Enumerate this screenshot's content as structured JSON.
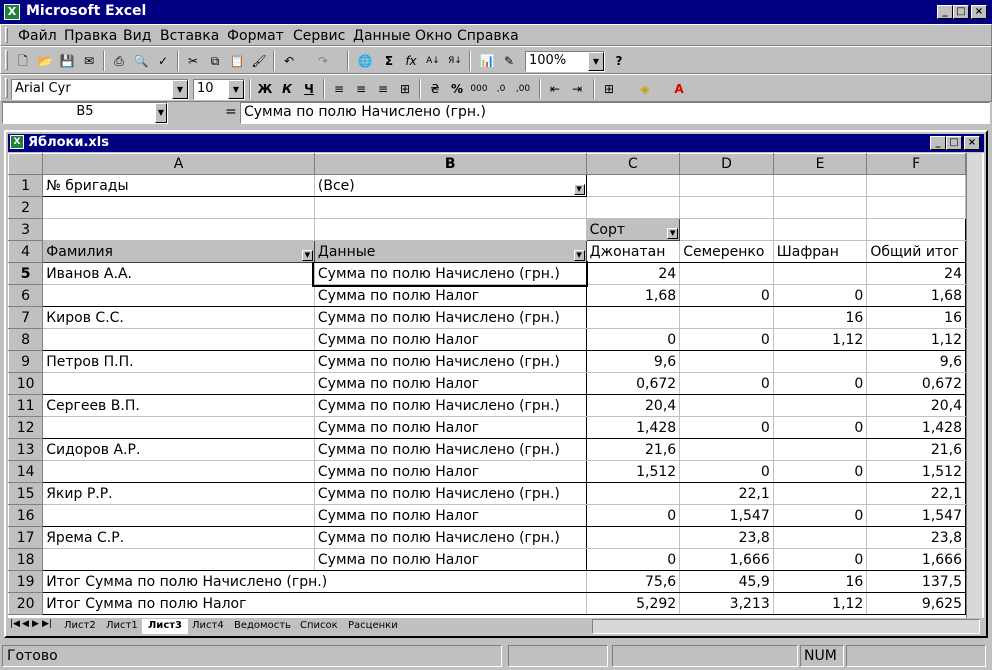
{
  "app": {
    "title": "Microsoft Excel",
    "icon": "excel-icon"
  },
  "menu": [
    "Файл",
    "Правка",
    "Вид",
    "Вставка",
    "Формат",
    "Сервис",
    "Данные",
    "Окно",
    "Справка"
  ],
  "toolbar": {
    "zoom": "100%"
  },
  "format": {
    "font": "Arial Cyr",
    "size": "10"
  },
  "formula_bar": {
    "cell_ref": "B5",
    "equals": "=",
    "content": "Сумма по полю Начислено (грн.)"
  },
  "workbook": {
    "title": "Яблоки.xls"
  },
  "grid": {
    "columns": [
      "A",
      "B",
      "C",
      "D",
      "E",
      "F"
    ],
    "row1": {
      "label": "№ бригады",
      "filter": "(Все)"
    },
    "sort_field": "Сорт",
    "headers": {
      "a": "Фамилия",
      "b": "Данные",
      "c": "Джонатан",
      "d": "Семеренко",
      "e": "Шафран",
      "f": "Общий итог"
    },
    "rows": [
      {
        "n": "5",
        "a": "Иванов А.А.",
        "b": "Сумма по полю Начислено (грн.)",
        "c": "24",
        "d": "",
        "e": "",
        "f": "24"
      },
      {
        "n": "6",
        "a": "",
        "b": "Сумма по полю Налог",
        "c": "1,68",
        "d": "0",
        "e": "0",
        "f": "1,68"
      },
      {
        "n": "7",
        "a": "Киров С.С.",
        "b": "Сумма по полю Начислено (грн.)",
        "c": "",
        "d": "",
        "e": "16",
        "f": "16"
      },
      {
        "n": "8",
        "a": "",
        "b": "Сумма по полю Налог",
        "c": "0",
        "d": "0",
        "e": "1,12",
        "f": "1,12"
      },
      {
        "n": "9",
        "a": "Петров П.П.",
        "b": "Сумма по полю Начислено (грн.)",
        "c": "9,6",
        "d": "",
        "e": "",
        "f": "9,6"
      },
      {
        "n": "10",
        "a": "",
        "b": "Сумма по полю Налог",
        "c": "0,672",
        "d": "0",
        "e": "0",
        "f": "0,672"
      },
      {
        "n": "11",
        "a": "Сергеев В.П.",
        "b": "Сумма по полю Начислено (грн.)",
        "c": "20,4",
        "d": "",
        "e": "",
        "f": "20,4"
      },
      {
        "n": "12",
        "a": "",
        "b": "Сумма по полю Налог",
        "c": "1,428",
        "d": "0",
        "e": "0",
        "f": "1,428"
      },
      {
        "n": "13",
        "a": "Сидоров А.Р.",
        "b": "Сумма по полю Начислено (грн.)",
        "c": "21,6",
        "d": "",
        "e": "",
        "f": "21,6"
      },
      {
        "n": "14",
        "a": "",
        "b": "Сумма по полю Налог",
        "c": "1,512",
        "d": "0",
        "e": "0",
        "f": "1,512"
      },
      {
        "n": "15",
        "a": "Якир Р.Р.",
        "b": "Сумма по полю Начислено (грн.)",
        "c": "",
        "d": "22,1",
        "e": "",
        "f": "22,1"
      },
      {
        "n": "16",
        "a": "",
        "b": "Сумма по полю Налог",
        "c": "0",
        "d": "1,547",
        "e": "0",
        "f": "1,547"
      },
      {
        "n": "17",
        "a": "Ярема С.Р.",
        "b": "Сумма по полю Начислено (грн.)",
        "c": "",
        "d": "23,8",
        "e": "",
        "f": "23,8"
      },
      {
        "n": "18",
        "a": "",
        "b": "Сумма по полю Налог",
        "c": "0",
        "d": "1,666",
        "e": "0",
        "f": "1,666"
      }
    ],
    "totals": [
      {
        "n": "19",
        "label": "Итог Сумма по полю Начислено (грн.)",
        "c": "75,6",
        "d": "45,9",
        "e": "16",
        "f": "137,5"
      },
      {
        "n": "20",
        "label": "Итог Сумма по полю Налог",
        "c": "5,292",
        "d": "3,213",
        "e": "1,12",
        "f": "9,625"
      }
    ]
  },
  "sheets": [
    "Лист2",
    "Лист1",
    "Лист3",
    "Лист4",
    "Ведомость",
    "Список",
    "Расценки"
  ],
  "active_sheet": "Лист3",
  "status": {
    "ready": "Готово",
    "num": "NUM"
  }
}
